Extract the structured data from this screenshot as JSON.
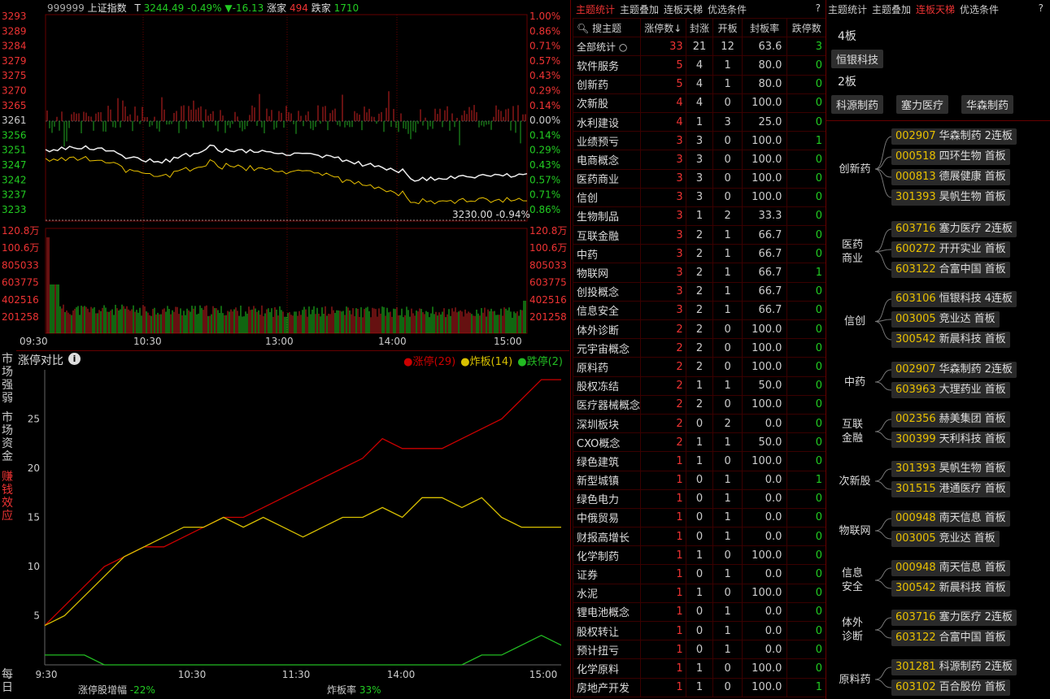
{
  "index_header": {
    "code": "999999",
    "name": "上证指数",
    "t_label": "T",
    "price": "3244.49",
    "pct": "-0.49%",
    "chg": "▼-16.13",
    "up_label": "涨家",
    "up_count": "494",
    "down_label": "跌家",
    "down_count": "1710"
  },
  "price_axis_left": [
    "3293",
    "3289",
    "3284",
    "3279",
    "3275",
    "3270",
    "3265",
    "3261",
    "3256",
    "3251",
    "3247",
    "3242",
    "3237",
    "3233"
  ],
  "price_axis_right": [
    "1.00%",
    "0.86%",
    "0.71%",
    "0.57%",
    "0.43%",
    "0.29%",
    "0.14%",
    "0.00%",
    "0.14%",
    "0.29%",
    "0.43%",
    "0.57%",
    "0.71%",
    "0.86%"
  ],
  "low_marker": "3230.00 -0.94%",
  "vol_axis_left": [
    "120.8万",
    "100.6万",
    "805033",
    "603775",
    "402516",
    "201258"
  ],
  "vol_axis_right": [
    "120.8万",
    "100.6万",
    "805033",
    "603775",
    "402516",
    "201258"
  ],
  "time_axis": [
    "09:30",
    "10:30",
    "13:00",
    "14:00",
    "15:00"
  ],
  "compare_panel": {
    "title": "涨停对比",
    "info_icon": "i",
    "legend": [
      {
        "label": "涨停(29)",
        "color": "#cc0000"
      },
      {
        "label": "炸板(14)",
        "color": "#d8c000"
      },
      {
        "label": "跌停(2)",
        "color": "#22bb22"
      }
    ],
    "side_tabs": [
      "市场强弱",
      "市场资金",
      "赚钱效应",
      "每日"
    ],
    "footer_left_label": "涨停股增幅",
    "footer_left_value": "-22%",
    "footer_right_label": "炸板率",
    "footer_right_value": "33%"
  },
  "chart_data": {
    "type": "line",
    "x_labels": [
      "9:30",
      "10:30",
      "11:30",
      "14:00",
      "15:00"
    ],
    "yticks": [
      5,
      10,
      15,
      20,
      25
    ],
    "ylim": [
      0,
      30
    ],
    "series": [
      {
        "name": "涨停",
        "color": "#cc0000",
        "values": [
          4,
          6,
          8,
          10,
          11,
          12,
          12,
          13,
          14,
          15,
          15,
          16,
          17,
          18,
          19,
          20,
          21,
          23,
          22,
          22,
          22,
          23,
          24,
          25,
          27,
          29,
          29
        ]
      },
      {
        "name": "炸板",
        "color": "#d8c000",
        "values": [
          4,
          5,
          7,
          9,
          11,
          12,
          13,
          14,
          14,
          15,
          14,
          15,
          14,
          13,
          14,
          15,
          15,
          16,
          15,
          17,
          17,
          16,
          17,
          15,
          14,
          14,
          14
        ]
      },
      {
        "name": "跌停",
        "color": "#22bb22",
        "values": [
          1,
          1,
          1,
          0,
          0,
          0,
          0,
          0,
          0,
          0,
          0,
          0,
          0,
          0,
          0,
          0,
          0,
          0,
          0,
          0,
          0,
          0,
          1,
          1,
          2,
          3,
          2
        ]
      }
    ]
  },
  "mid_tabs": [
    "主题统计",
    "主题叠加",
    "连板天梯",
    "优选条件"
  ],
  "mid_active": "主题统计",
  "search_label": "搜主题",
  "table_headers": [
    "涨停数↓",
    "封涨",
    "开板",
    "封板率",
    "跌停数"
  ],
  "summary_row": {
    "name": "全部统计",
    "n1": "33",
    "n2": "21",
    "n3": "12",
    "n4": "63.6",
    "n5": "3"
  },
  "table_rows": [
    {
      "name": "软件服务",
      "n1": "5",
      "n2": "4",
      "n3": "1",
      "n4": "80.0",
      "n5": "0"
    },
    {
      "name": "创新药",
      "n1": "5",
      "n2": "4",
      "n3": "1",
      "n4": "80.0",
      "n5": "0"
    },
    {
      "name": "次新股",
      "n1": "4",
      "n2": "4",
      "n3": "0",
      "n4": "100.0",
      "n5": "0"
    },
    {
      "name": "水利建设",
      "n1": "4",
      "n2": "1",
      "n3": "3",
      "n4": "25.0",
      "n5": "0"
    },
    {
      "name": "业绩预亏",
      "n1": "3",
      "n2": "3",
      "n3": "0",
      "n4": "100.0",
      "n5": "1"
    },
    {
      "name": "电商概念",
      "n1": "3",
      "n2": "3",
      "n3": "0",
      "n4": "100.0",
      "n5": "0"
    },
    {
      "name": "医药商业",
      "n1": "3",
      "n2": "3",
      "n3": "0",
      "n4": "100.0",
      "n5": "0"
    },
    {
      "name": "信创",
      "n1": "3",
      "n2": "3",
      "n3": "0",
      "n4": "100.0",
      "n5": "0"
    },
    {
      "name": "生物制品",
      "n1": "3",
      "n2": "1",
      "n3": "2",
      "n4": "33.3",
      "n5": "0"
    },
    {
      "name": "互联金融",
      "n1": "3",
      "n2": "2",
      "n3": "1",
      "n4": "66.7",
      "n5": "0"
    },
    {
      "name": "中药",
      "n1": "3",
      "n2": "2",
      "n3": "1",
      "n4": "66.7",
      "n5": "0"
    },
    {
      "name": "物联网",
      "n1": "3",
      "n2": "2",
      "n3": "1",
      "n4": "66.7",
      "n5": "1"
    },
    {
      "name": "创投概念",
      "n1": "3",
      "n2": "2",
      "n3": "1",
      "n4": "66.7",
      "n5": "0"
    },
    {
      "name": "信息安全",
      "n1": "3",
      "n2": "2",
      "n3": "1",
      "n4": "66.7",
      "n5": "0"
    },
    {
      "name": "体外诊断",
      "n1": "2",
      "n2": "2",
      "n3": "0",
      "n4": "100.0",
      "n5": "0"
    },
    {
      "name": "元宇宙概念",
      "n1": "2",
      "n2": "2",
      "n3": "0",
      "n4": "100.0",
      "n5": "0"
    },
    {
      "name": "原料药",
      "n1": "2",
      "n2": "2",
      "n3": "0",
      "n4": "100.0",
      "n5": "0"
    },
    {
      "name": "股权冻结",
      "n1": "2",
      "n2": "1",
      "n3": "1",
      "n4": "50.0",
      "n5": "0"
    },
    {
      "name": "医疗器械概念",
      "n1": "2",
      "n2": "2",
      "n3": "0",
      "n4": "100.0",
      "n5": "0"
    },
    {
      "name": "深圳板块",
      "n1": "2",
      "n2": "0",
      "n3": "2",
      "n4": "0.0",
      "n5": "0"
    },
    {
      "name": "CXO概念",
      "n1": "2",
      "n2": "1",
      "n3": "1",
      "n4": "50.0",
      "n5": "0"
    },
    {
      "name": "绿色建筑",
      "n1": "1",
      "n2": "1",
      "n3": "0",
      "n4": "100.0",
      "n5": "0"
    },
    {
      "name": "新型城镇",
      "n1": "1",
      "n2": "0",
      "n3": "1",
      "n4": "0.0",
      "n5": "1"
    },
    {
      "name": "绿色电力",
      "n1": "1",
      "n2": "0",
      "n3": "1",
      "n4": "0.0",
      "n5": "0"
    },
    {
      "name": "中俄贸易",
      "n1": "1",
      "n2": "0",
      "n3": "1",
      "n4": "0.0",
      "n5": "0"
    },
    {
      "name": "财报高增长",
      "n1": "1",
      "n2": "0",
      "n3": "1",
      "n4": "0.0",
      "n5": "0"
    },
    {
      "name": "化学制药",
      "n1": "1",
      "n2": "1",
      "n3": "0",
      "n4": "100.0",
      "n5": "0"
    },
    {
      "name": "证券",
      "n1": "1",
      "n2": "0",
      "n3": "1",
      "n4": "0.0",
      "n5": "0"
    },
    {
      "name": "水泥",
      "n1": "1",
      "n2": "1",
      "n3": "0",
      "n4": "100.0",
      "n5": "0"
    },
    {
      "name": "锂电池概念",
      "n1": "1",
      "n2": "0",
      "n3": "1",
      "n4": "0.0",
      "n5": "0"
    },
    {
      "name": "股权转让",
      "n1": "1",
      "n2": "0",
      "n3": "1",
      "n4": "0.0",
      "n5": "0"
    },
    {
      "name": "预计扭亏",
      "n1": "1",
      "n2": "0",
      "n3": "1",
      "n4": "0.0",
      "n5": "0"
    },
    {
      "name": "化学原料",
      "n1": "1",
      "n2": "1",
      "n3": "0",
      "n4": "100.0",
      "n5": "0"
    },
    {
      "name": "房地产开发",
      "n1": "1",
      "n2": "1",
      "n3": "0",
      "n4": "100.0",
      "n5": "1"
    }
  ],
  "right_tabs": [
    "主题统计",
    "主题叠加",
    "连板天梯",
    "优选条件"
  ],
  "right_active": "连板天梯",
  "ladder": [
    {
      "level": "4板",
      "stocks": [
        "恒银科技"
      ]
    },
    {
      "level": "2板",
      "stocks": [
        "科源制药",
        "塞力医疗",
        "华森制药"
      ]
    }
  ],
  "themes": [
    {
      "name": "创新药",
      "stocks": [
        [
          "002907",
          "华森制药",
          "2连板"
        ],
        [
          "000518",
          "四环生物",
          "首板"
        ],
        [
          "000813",
          "德展健康",
          "首板"
        ],
        [
          "301393",
          "昊帆生物",
          "首板"
        ]
      ]
    },
    {
      "name": "医药商业",
      "stocks": [
        [
          "603716",
          "塞力医疗",
          "2连板"
        ],
        [
          "600272",
          "开开实业",
          "首板"
        ],
        [
          "603122",
          "合富中国",
          "首板"
        ]
      ]
    },
    {
      "name": "信创",
      "stocks": [
        [
          "603106",
          "恒银科技",
          "4连板"
        ],
        [
          "003005",
          "竞业达",
          "首板"
        ],
        [
          "300542",
          "新晨科技",
          "首板"
        ]
      ]
    },
    {
      "name": "中药",
      "stocks": [
        [
          "002907",
          "华森制药",
          "2连板"
        ],
        [
          "603963",
          "大理药业",
          "首板"
        ]
      ]
    },
    {
      "name": "互联金融",
      "stocks": [
        [
          "002356",
          "赫美集团",
          "首板"
        ],
        [
          "300399",
          "天利科技",
          "首板"
        ]
      ]
    },
    {
      "name": "次新股",
      "stocks": [
        [
          "301393",
          "昊帆生物",
          "首板"
        ],
        [
          "301515",
          "港通医疗",
          "首板"
        ]
      ]
    },
    {
      "name": "物联网",
      "stocks": [
        [
          "000948",
          "南天信息",
          "首板"
        ],
        [
          "003005",
          "竞业达",
          "首板"
        ]
      ]
    },
    {
      "name": "信息安全",
      "stocks": [
        [
          "000948",
          "南天信息",
          "首板"
        ],
        [
          "300542",
          "新晨科技",
          "首板"
        ]
      ]
    },
    {
      "name": "体外诊断",
      "stocks": [
        [
          "603716",
          "塞力医疗",
          "2连板"
        ],
        [
          "603122",
          "合富中国",
          "首板"
        ]
      ]
    },
    {
      "name": "原料药",
      "stocks": [
        [
          "301281",
          "科源制药",
          "2连板"
        ],
        [
          "603102",
          "百合股份",
          "首板"
        ]
      ]
    }
  ],
  "help": "?"
}
